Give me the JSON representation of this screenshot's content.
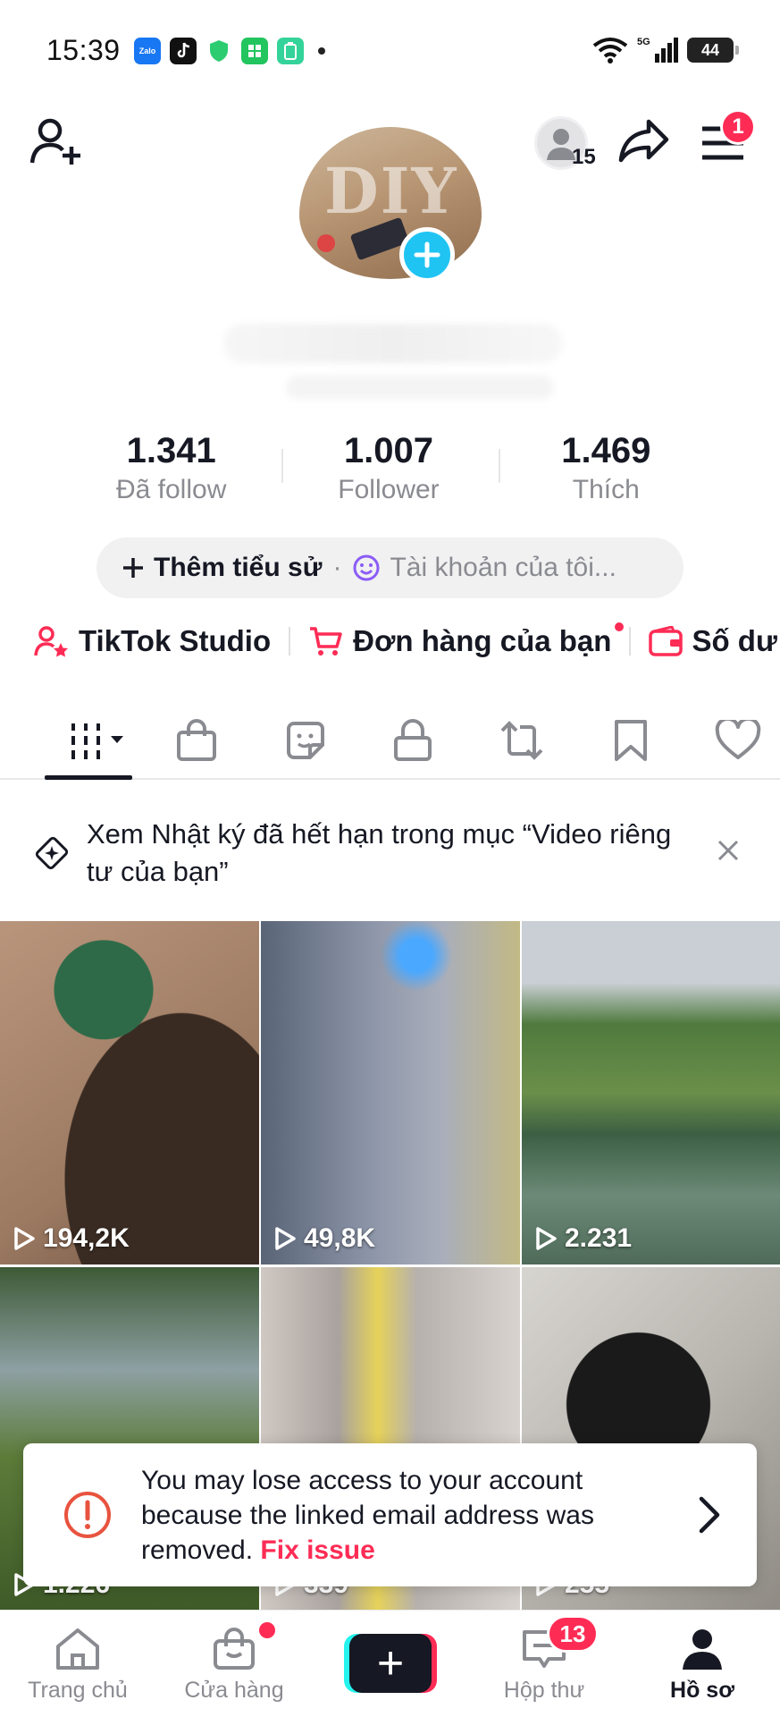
{
  "status_bar": {
    "time": "15:39",
    "apps": [
      "Zalo",
      "TikTok",
      "Shield",
      "Green app",
      "Battery app"
    ],
    "network": "5G",
    "battery": "44"
  },
  "profile": {
    "avatar_text": "DIY",
    "friends_count": "15",
    "menu_badge": "1"
  },
  "stats": [
    {
      "value": "1.341",
      "label": "Đã follow"
    },
    {
      "value": "1.007",
      "label": "Follower"
    },
    {
      "value": "1.469",
      "label": "Thích"
    }
  ],
  "bio": {
    "add_label": "Thêm tiểu sử",
    "separator": "·",
    "account_label": "Tài khoản của tôi..."
  },
  "links": [
    {
      "label": "TikTok Studio"
    },
    {
      "label": "Đơn hàng của bạn"
    },
    {
      "label": "Số dư"
    }
  ],
  "notice": {
    "text": "Xem Nhật ký đã hết hạn trong mục “Video riêng tư của bạn”"
  },
  "videos": [
    {
      "views": "194,2K"
    },
    {
      "views": "49,8K"
    },
    {
      "views": "2.231"
    },
    {
      "views": "1.226"
    },
    {
      "views": "339"
    },
    {
      "views": "255"
    }
  ],
  "toast": {
    "message": "You may lose access to your account because the linked email address was removed.",
    "action": "Fix issue"
  },
  "bottom_nav": {
    "home": "Trang chủ",
    "shop": "Cửa hàng",
    "inbox": "Hộp thư",
    "inbox_badge": "13",
    "profile": "Hồ sơ"
  },
  "colors": {
    "accent": "#fe2c55",
    "cyan": "#25f4ee",
    "text": "#161823",
    "muted": "#8a8b91"
  }
}
